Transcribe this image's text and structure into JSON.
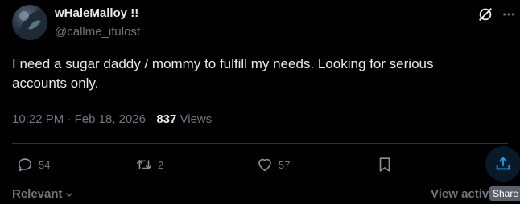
{
  "author": {
    "display_name": "wHaleMalloy !!",
    "handle": "@callme_ifulost"
  },
  "tweet": {
    "text": "I need a sugar daddy / mommy to fulfill my needs. Looking for serious accounts only."
  },
  "meta": {
    "time": "10:22 PM",
    "separator1": "·",
    "date": "Feb 18, 2026",
    "separator2": "·",
    "view_count": "837",
    "views_label": "Views"
  },
  "actions": {
    "replies": "54",
    "reposts": "2",
    "likes": "57"
  },
  "tooltip": {
    "share": "Share"
  },
  "footer": {
    "sort_label": "Relevant",
    "view_activity": "View activity"
  },
  "colors": {
    "background": "#000000",
    "text_primary": "#e7e9ea",
    "text_secondary": "#71767b",
    "accent": "#1d9bf0"
  },
  "icons": {
    "grok": "grok-icon",
    "more": "more-icon",
    "reply": "reply-icon",
    "repost": "repost-icon",
    "like": "heart-icon",
    "bookmark": "bookmark-icon",
    "share": "share-icon"
  }
}
